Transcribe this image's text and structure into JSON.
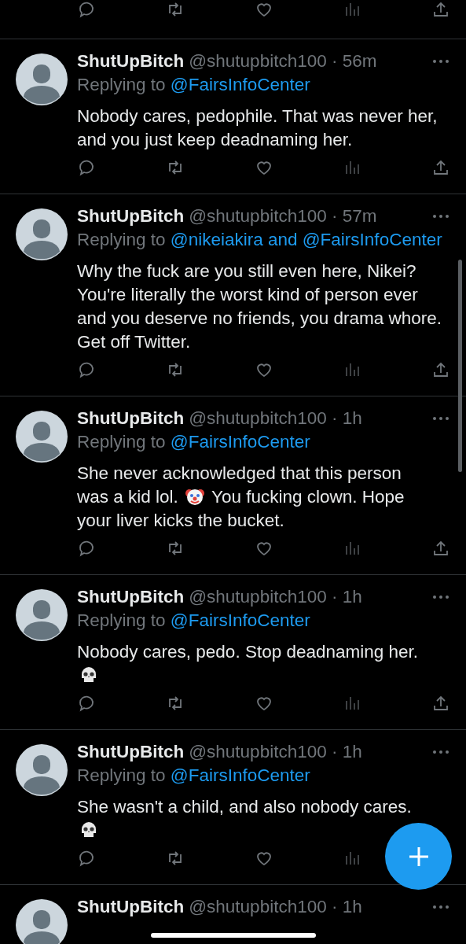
{
  "tweets": [
    {
      "name": "ShutUpBitch",
      "meta": "@shutupbitch100 · 56m",
      "reply_prefix": "Replying to",
      "reply_to": "@FairsInfoCenter",
      "body": [
        {
          "kind": "text",
          "text": "Nobody cares, pedophile. That was never her, and you just keep deadnaming her."
        }
      ]
    },
    {
      "name": "ShutUpBitch",
      "meta": "@shutupbitch100 · 57m",
      "reply_prefix": "Replying to",
      "reply_to": "@nikeiakira and @FairsInfoCenter",
      "body": [
        {
          "kind": "text",
          "text": "Why the fuck are you still even here, Nikei? You're literally the worst kind of person ever and you deserve no friends, you drama whore. Get off Twitter."
        }
      ]
    },
    {
      "name": "ShutUpBitch",
      "meta": "@shutupbitch100 · 1h",
      "reply_prefix": "Replying to",
      "reply_to": "@FairsInfoCenter",
      "body": [
        {
          "kind": "text",
          "text": "She never acknowledged that this person"
        },
        {
          "kind": "text",
          "text": "was a kid lol."
        },
        {
          "kind": "clown"
        },
        {
          "kind": "text",
          "text": "You fucking clown. Hope"
        },
        {
          "kind": "text",
          "text": "your liver kicks the bucket."
        }
      ]
    },
    {
      "name": "ShutUpBitch",
      "meta": "@shutupbitch100 · 1h",
      "reply_prefix": "Replying to",
      "reply_to": "@FairsInfoCenter",
      "body": [
        {
          "kind": "text",
          "text": "Nobody cares, pedo. Stop deadnaming her."
        },
        {
          "kind": "skull"
        }
      ]
    },
    {
      "name": "ShutUpBitch",
      "meta": "@shutupbitch100 · 1h",
      "reply_prefix": "Replying to",
      "reply_to": "@FairsInfoCenter",
      "body": [
        {
          "kind": "text",
          "text": "She wasn't a child, and also nobody cares."
        },
        {
          "kind": "skull"
        }
      ]
    },
    {
      "name": "ShutUpBitch",
      "meta": "@shutupbitch100 · 1h"
    }
  ]
}
